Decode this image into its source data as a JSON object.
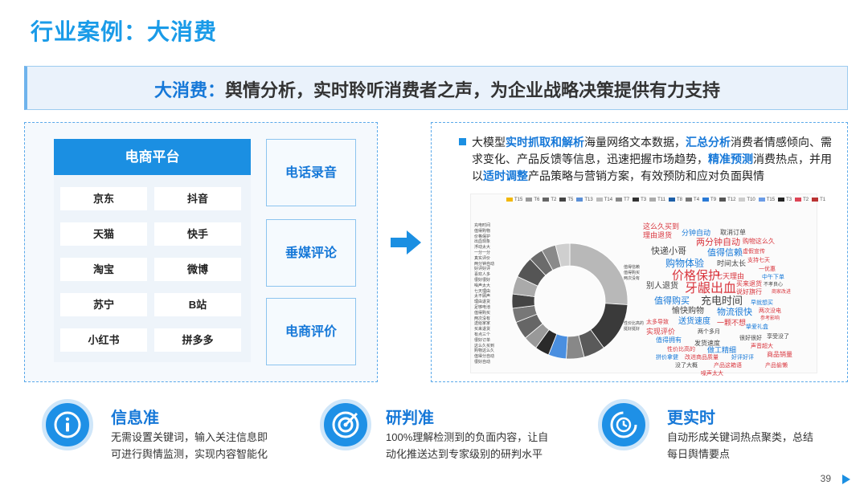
{
  "page_title": "行业案例：大消费",
  "banner": {
    "accent": "大消费：",
    "text": "舆情分析，实时聆听消费者之声，为企业战略决策提供有力支持"
  },
  "left": {
    "platform_header": "电商平台",
    "platforms": [
      "京东",
      "抖音",
      "天猫",
      "快手",
      "淘宝",
      "微博",
      "苏宁",
      "B站",
      "小红书",
      "拼多多"
    ],
    "sources": [
      "电话录音",
      "垂媒评论",
      "电商评价"
    ]
  },
  "right": {
    "desc": {
      "p1": "大模型",
      "h1": "实时抓取和解析",
      "p2": "海量网络文本数据，",
      "h2": "汇总分析",
      "p3": "消费者情感倾向、需求变化、产品反馈等信息，迅速把握市场趋势，",
      "h3": "精准预测",
      "p4": "消费热点，并用以",
      "h4": "适时调整",
      "p5": "产品策略与营销方案，有效预防和应对负面舆情"
    },
    "viz": {
      "legend": [
        "T15",
        "T6",
        "T2",
        "T5",
        "T13",
        "T14",
        "T7",
        "T3",
        "T11",
        "T8",
        "T4",
        "T9",
        "T12",
        "T10",
        "T15",
        "T3",
        "T2",
        "T1"
      ],
      "left_labels": [
        "充电时间",
        "值得购物",
        "价格保护",
        "出血现象",
        "浮动太大",
        "一分一分",
        "真实评价",
        "两分钟自动",
        "好评好评",
        "喜欢人多",
        "很好很好",
        "噪声太大",
        "七天理由",
        "太不顾声",
        "理由退货",
        "足够电池",
        "值得购买",
        "两次没有",
        "送给家家",
        "买来退货",
        "有点三个",
        "很好订单",
        "这么久买到",
        "购物这么久",
        "值得分自动",
        "很好自动"
      ],
      "mid_labels": [
        "值得信赖",
        "值得购买",
        "两次没有"
      ],
      "mid_labels2": [
        "性价比高的",
        "挺好挺好"
      ]
    },
    "words": [
      {
        "t": "这么久买到",
        "c": "#d9363e"
      },
      {
        "t": "理由退货",
        "c": "#d9363e"
      },
      {
        "t": "分钟自动",
        "c": "#1678d8"
      },
      {
        "t": "取消订单",
        "c": "#444"
      },
      {
        "t": "两分钟自动",
        "c": "#d9363e"
      },
      {
        "t": "购物这么久",
        "c": "#d9363e"
      },
      {
        "t": "快递小哥",
        "c": "#444"
      },
      {
        "t": "值得信赖",
        "c": "#1678d8"
      },
      {
        "t": "虚假宣传",
        "c": "#d9363e"
      },
      {
        "t": "支持七天",
        "c": "#d9363e"
      },
      {
        "t": "购物体验",
        "c": "#1678d8"
      },
      {
        "t": "时间太长",
        "c": "#444"
      },
      {
        "t": "一优惠",
        "c": "#d9363e"
      },
      {
        "t": "价格保护",
        "c": "#d9363e"
      },
      {
        "t": "七天理由",
        "c": "#d9363e"
      },
      {
        "t": "中午下单",
        "c": "#1678d8"
      },
      {
        "t": "不孝良心",
        "c": "#444"
      },
      {
        "t": "别人退货",
        "c": "#444"
      },
      {
        "t": "牙龈出血",
        "c": "#d9363e"
      },
      {
        "t": "买来退货",
        "c": "#d9363e"
      },
      {
        "t": "商家改进",
        "c": "#d9363e"
      },
      {
        "t": "充电时间",
        "c": "#444"
      },
      {
        "t": "说好旗行",
        "c": "#d9363e"
      },
      {
        "t": "值得购买",
        "c": "#1678d8"
      },
      {
        "t": "愉快购物",
        "c": "#444"
      },
      {
        "t": "物流很快",
        "c": "#1678d8"
      },
      {
        "t": "早就想买",
        "c": "#1678d8"
      },
      {
        "t": "两次没电",
        "c": "#d9363e"
      },
      {
        "t": "太多导致",
        "c": "#d9363e"
      },
      {
        "t": "送货速度",
        "c": "#1678d8"
      },
      {
        "t": "一颗不想",
        "c": "#d9363e"
      },
      {
        "t": "参考影响",
        "c": "#d9363e"
      },
      {
        "t": "实现评价",
        "c": "#d9363e"
      },
      {
        "t": "两个多月",
        "c": "#444"
      },
      {
        "t": "挚爱礼盒",
        "c": "#1678d8"
      },
      {
        "t": "值得拥有",
        "c": "#1678d8"
      },
      {
        "t": "发货速度",
        "c": "#444"
      },
      {
        "t": "很好很好",
        "c": "#444"
      },
      {
        "t": "享受没了",
        "c": "#444"
      },
      {
        "t": "做工精细",
        "c": "#1678d8"
      },
      {
        "t": "声音超大",
        "c": "#d9363e"
      },
      {
        "t": "性价比高的",
        "c": "#d9363e"
      },
      {
        "t": "好评好评",
        "c": "#1678d8"
      },
      {
        "t": "拼价拿健",
        "c": "#1678d8"
      },
      {
        "t": "改进商品质量",
        "c": "#d9363e"
      },
      {
        "t": "商品销量",
        "c": "#d9363e"
      },
      {
        "t": "没了大概",
        "c": "#444"
      },
      {
        "t": "产品这箱语",
        "c": "#d9363e"
      },
      {
        "t": "产品偷懒",
        "c": "#d9363e"
      },
      {
        "t": "噪声太大",
        "c": "#d9363e"
      }
    ]
  },
  "features": [
    {
      "title": "信息准",
      "desc1": "无需设置关键词，输入关注信息即",
      "desc2": "可进行舆情监测，实现内容智能化",
      "icon": "info-icon"
    },
    {
      "title": "研判准",
      "desc1": "100%理解检测到的负面内容，让自",
      "desc2": "动化推送达到专家级别的研判水平",
      "icon": "target-icon"
    },
    {
      "title": "更实时",
      "desc1": "自动形成关键词热点聚类，总结",
      "desc2": "每日舆情要点",
      "icon": "clock-icon"
    }
  ],
  "page_number": "39",
  "colors": {
    "accent": "#1b8fe2",
    "title": "#1a9be8",
    "negative": "#d9363e"
  }
}
